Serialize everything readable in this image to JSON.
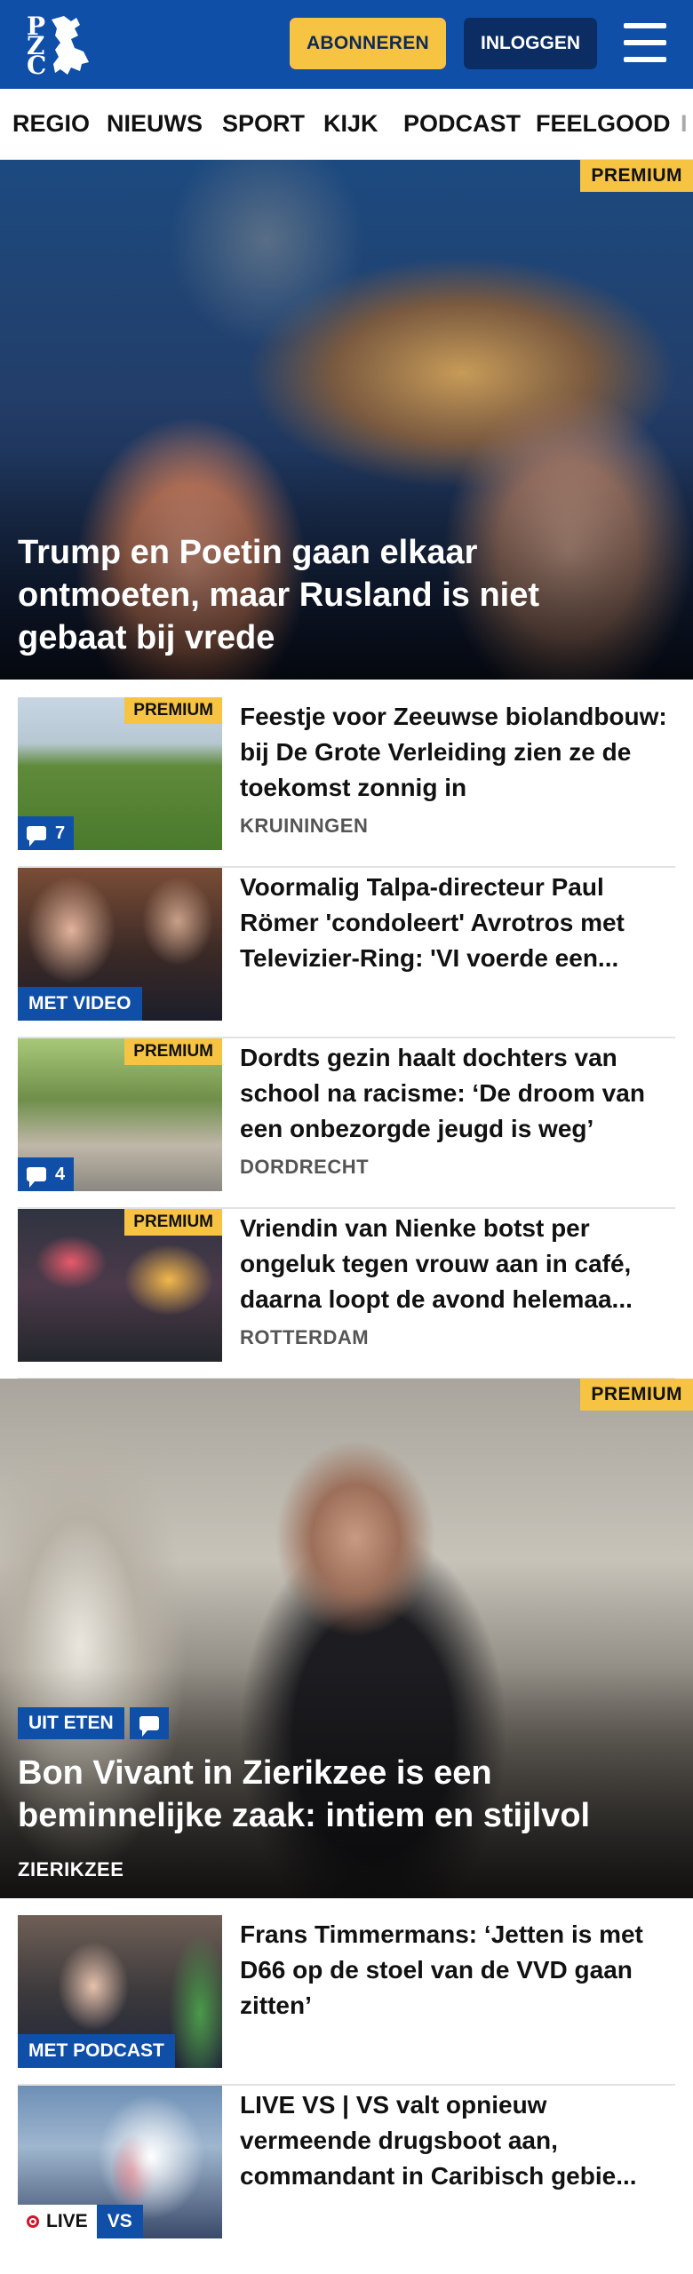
{
  "header": {
    "logo_letters": [
      "P",
      "Z",
      "C"
    ],
    "subscribe_label": "ABONNEREN",
    "login_label": "INLOGGEN"
  },
  "nav": {
    "items": [
      "REGIO",
      "NIEUWS",
      "SPORT",
      "KIJK",
      "PODCAST",
      "FEELGOOD",
      "I"
    ]
  },
  "hero": {
    "badge": "PREMIUM",
    "title": "Trump en Poetin gaan elkaar ontmoeten, maar Rusland is niet gebaat bij vrede"
  },
  "articles": [
    {
      "badge": "PREMIUM",
      "comments": "7",
      "title": "Feestje voor Zeeuwse bioland­bouw: bij De Grote Verleiding zien ze de toekomst zonnig in",
      "location": "KRUININGEN"
    },
    {
      "label": "MET VIDEO",
      "title": "Voormalig Talpa-directeur Paul Römer 'condoleert' Avrotros met Televizier-Ring: 'VI voerde een..."
    },
    {
      "badge": "PREMIUM",
      "comments": "4",
      "title": "Dordts gezin haalt dochters van school na racisme: ‘De droom van een onbezorgde jeugd is weg’",
      "location": "DORDRECHT"
    },
    {
      "badge": "PREMIUM",
      "title": "Vriendin van Nienke botst per ongeluk tegen vrouw aan in café, daarna loopt de avond helemaa...",
      "location": "ROTTERDAM"
    }
  ],
  "feature": {
    "badge": "PREMIUM",
    "category": "UIT ETEN",
    "title": "Bon Vivant in Zierikzee is een beminnelijke zaak: intiem en stijlvol",
    "location": "ZIERIKZEE"
  },
  "articles2": [
    {
      "label": "MET PODCAST",
      "title": "Frans Timmermans: ‘Jetten is met D66 op de stoel van de VVD gaan zitten’"
    },
    {
      "live_label": "LIVE",
      "tag": "VS",
      "title": "LIVE VS | VS valt opnieuw vermeende drugsboot aan, commandant in Caribisch gebie..."
    }
  ],
  "icons": {
    "comments": "speech-bubble-icon",
    "menu": "hamburger-menu-icon",
    "live": "live-dot-icon"
  },
  "colors": {
    "brand_blue": "#0f4fa8",
    "premium_yellow": "#f6c343",
    "login_dark": "#0b2d63",
    "live_red": "#d0162a"
  }
}
